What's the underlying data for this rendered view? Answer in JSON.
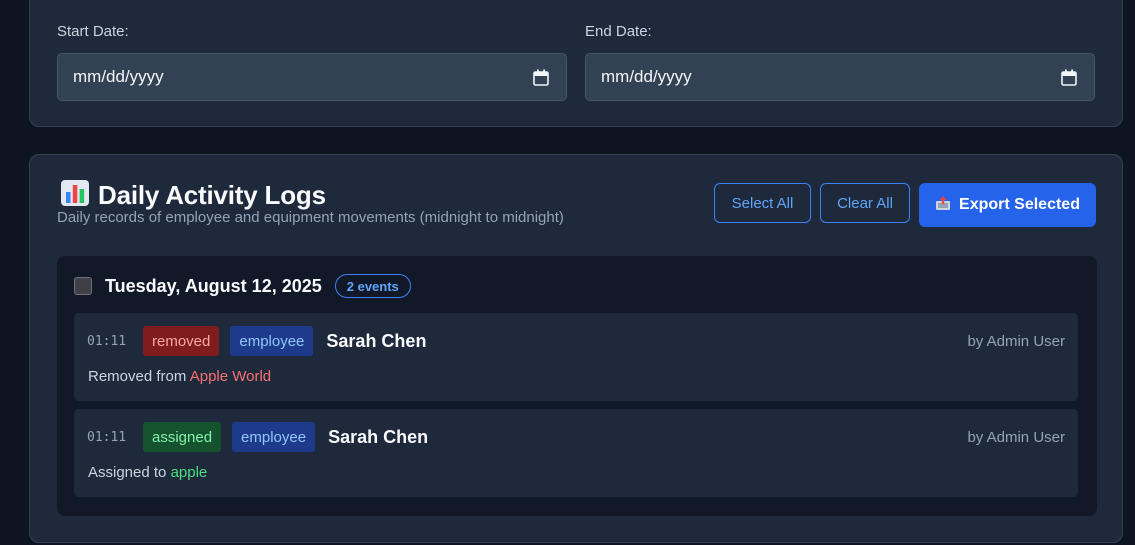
{
  "filters": {
    "start_label": "Start Date:",
    "start_placeholder": "mm/dd/yyyy",
    "end_label": "End Date:",
    "end_placeholder": "mm/dd/yyyy",
    "calendar_icon": "calendar-icon"
  },
  "logs": {
    "title_icon": "bar-chart-emoji",
    "title": "Daily Activity Logs",
    "subtitle": "Daily records of employee and equipment movements (midnight to midnight)",
    "select_all_label": "Select All",
    "clear_all_label": "Clear All",
    "export_icon": "outbox-emoji",
    "export_label": "Export Selected",
    "days": [
      {
        "date": "Tuesday, August 12, 2025",
        "events_count": "2 events",
        "events": [
          {
            "time": "01:11",
            "action": "removed",
            "type": "employee",
            "person": "Sarah Chen",
            "by": "by Admin User",
            "desc_prefix": "Removed from ",
            "location": "Apple World"
          },
          {
            "time": "01:11",
            "action": "assigned",
            "type": "employee",
            "person": "Sarah Chen",
            "by": "by Admin User",
            "desc_prefix": "Assigned to ",
            "location": "apple"
          }
        ]
      }
    ]
  },
  "colors": {
    "background": "#0d1422",
    "card": "#1e293b",
    "accent": "#2563eb",
    "removed": "#7f1d1d",
    "assigned": "#14532d"
  }
}
